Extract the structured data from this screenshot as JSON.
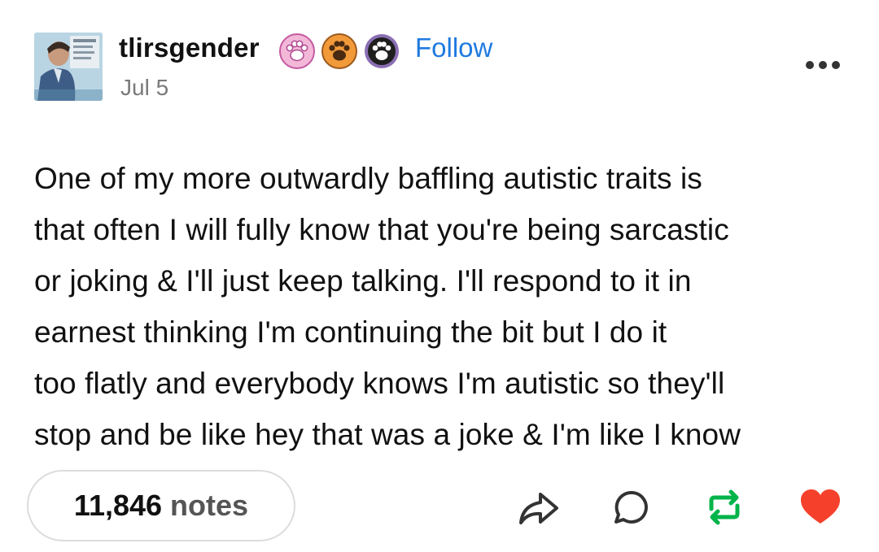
{
  "post": {
    "username": "tlirsgender",
    "date": "Jul 5",
    "follow_label": "Follow",
    "badges": [
      "pink-paw-badge-icon",
      "orange-paw-badge-icon",
      "dark-paw-badge-icon"
    ],
    "body_lines": [
      "One of my more outwardly baffling autistic traits is",
      "that often I will fully know that you're being sarcastic",
      "or joking & I'll just keep talking. I'll respond to it in",
      "earnest thinking I'm continuing the bit but I do it",
      "too flatly and everybody knows I'm autistic so they'll",
      "stop and be like hey that was a joke & I'm like I know"
    ]
  },
  "footer": {
    "notes_count": "11,846",
    "notes_label": "notes",
    "icons": [
      "share-icon",
      "reply-icon",
      "reblog-icon",
      "like-icon"
    ]
  },
  "colors": {
    "follow": "#1f7ae0",
    "reblog": "#00b44a",
    "like": "#f5412b",
    "muted": "#7a7a7a"
  }
}
